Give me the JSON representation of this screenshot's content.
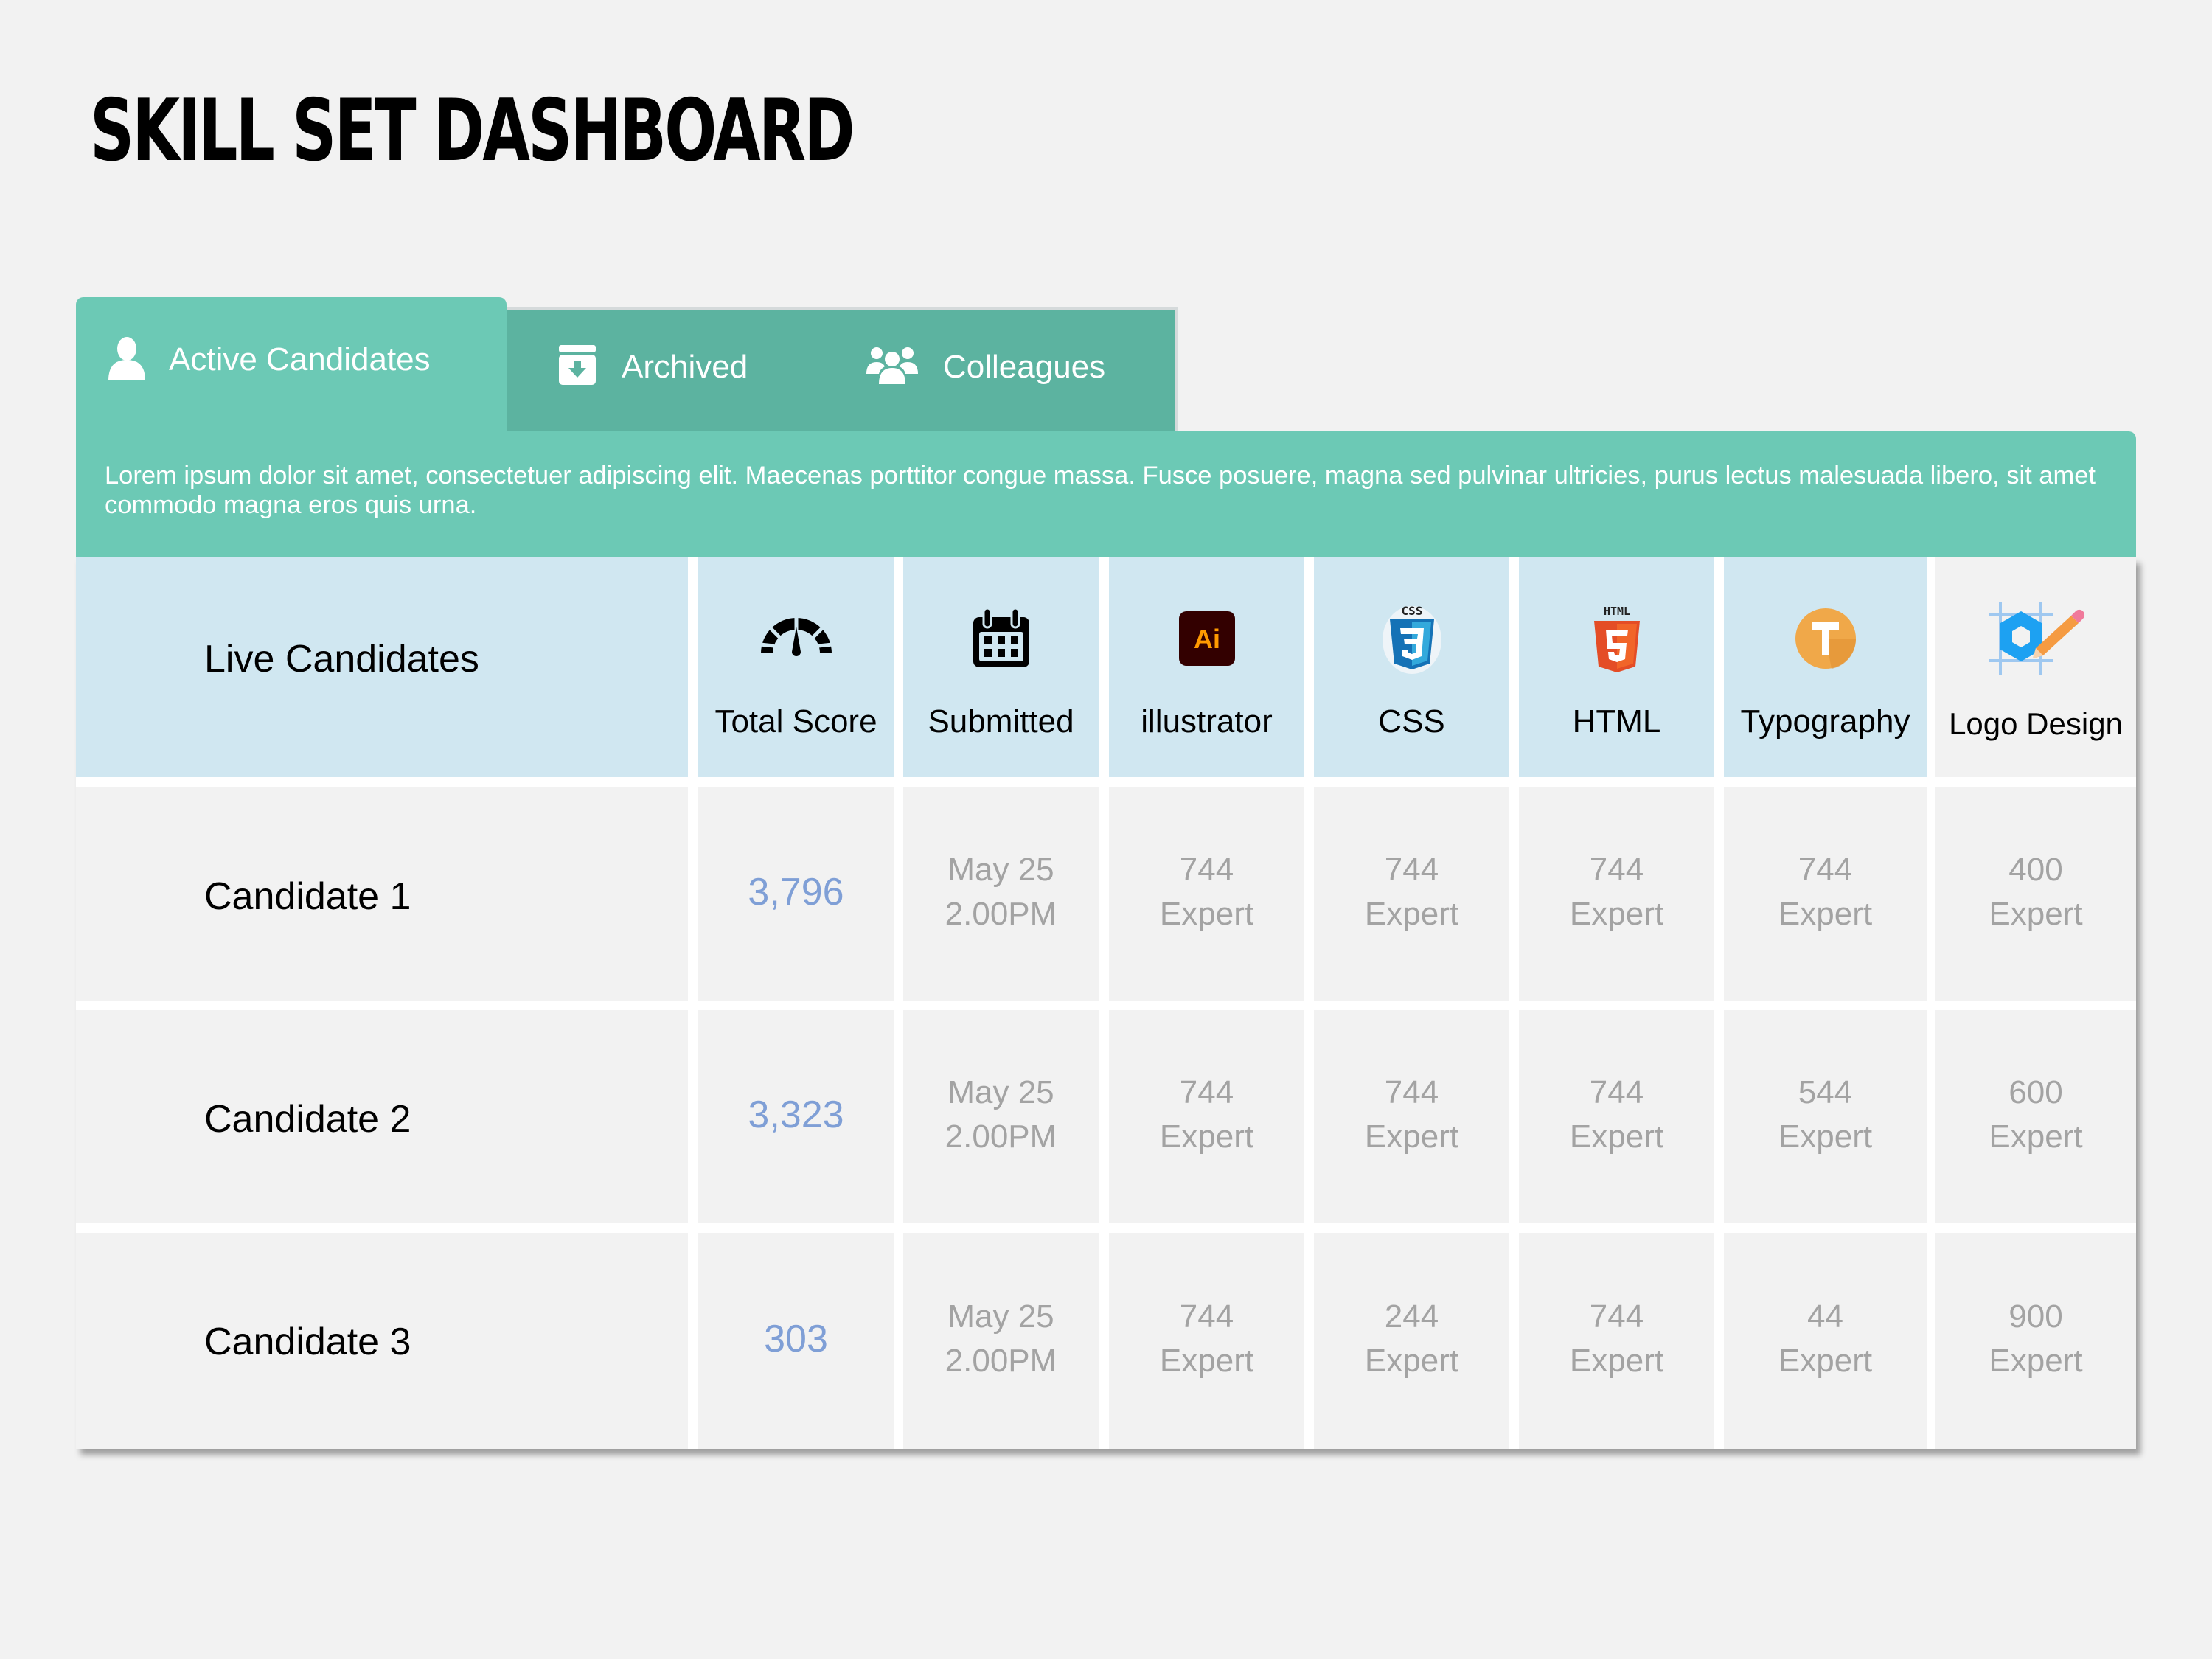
{
  "page": {
    "title": "SKILL SET DASHBOARD"
  },
  "tabs": [
    {
      "label": "Active Candidates",
      "icon": "person-icon",
      "active": true
    },
    {
      "label": "Archived",
      "icon": "archive-box-icon",
      "active": false
    },
    {
      "label": "Colleagues",
      "icon": "users-group-icon",
      "active": false
    }
  ],
  "description": "Lorem ipsum dolor sit amet, consectetuer adipiscing elit. Maecenas porttitor congue massa. Fusce posuere, magna sed pulvinar ultricies, purus lectus malesuada libero, sit amet commodo magna eros quis urna.",
  "colors": {
    "accent_teal": "#6cc9b5",
    "tab_inactive_teal": "#5cb3a0",
    "header_blue": "#d0e7f1",
    "score_blue": "#7f9fd6",
    "value_gray": "#a3a3a3"
  },
  "table": {
    "first_header": "Live Candidates",
    "columns": [
      {
        "label": "Total Score",
        "icon": "speedometer-icon"
      },
      {
        "label": "Submitted",
        "icon": "calendar-icon"
      },
      {
        "label": "illustrator",
        "icon": "adobe-illustrator-icon"
      },
      {
        "label": "CSS",
        "icon": "css3-icon"
      },
      {
        "label": "HTML",
        "icon": "html5-icon"
      },
      {
        "label": "Typography",
        "icon": "typography-icon"
      },
      {
        "label": "Logo Design",
        "icon": "logo-design-icon"
      }
    ],
    "rows": [
      {
        "name": "Candidate 1",
        "total_score": "3,796",
        "submitted": {
          "date": "May 25",
          "time": "2.00PM"
        },
        "skills": [
          {
            "value": "744",
            "level": "Expert"
          },
          {
            "value": "744",
            "level": "Expert"
          },
          {
            "value": "744",
            "level": "Expert"
          },
          {
            "value": "744",
            "level": "Expert"
          },
          {
            "value": "400",
            "level": "Expert"
          }
        ]
      },
      {
        "name": "Candidate 2",
        "total_score": "3,323",
        "submitted": {
          "date": "May 25",
          "time": "2.00PM"
        },
        "skills": [
          {
            "value": "744",
            "level": "Expert"
          },
          {
            "value": "744",
            "level": "Expert"
          },
          {
            "value": "744",
            "level": "Expert"
          },
          {
            "value": "544",
            "level": "Expert"
          },
          {
            "value": "600",
            "level": "Expert"
          }
        ]
      },
      {
        "name": "Candidate 3",
        "total_score": "303",
        "submitted": {
          "date": "May 25",
          "time": "2.00PM"
        },
        "skills": [
          {
            "value": "744",
            "level": "Expert"
          },
          {
            "value": "244",
            "level": "Expert"
          },
          {
            "value": "744",
            "level": "Expert"
          },
          {
            "value": "44",
            "level": "Expert"
          },
          {
            "value": "900",
            "level": "Expert"
          }
        ]
      }
    ]
  }
}
